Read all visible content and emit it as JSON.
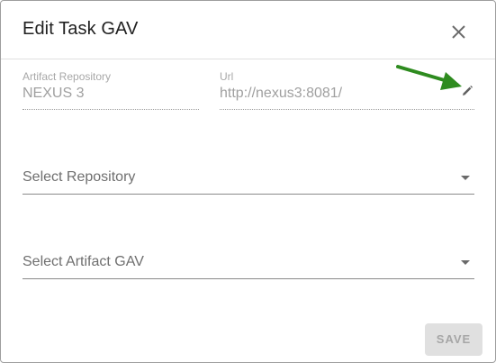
{
  "dialog": {
    "title": "Edit Task GAV",
    "close_icon": "close-icon"
  },
  "artifact_repository": {
    "label": "Artifact Repository",
    "value": "NEXUS 3"
  },
  "url": {
    "label": "Url",
    "value": "http://nexus3:8081/",
    "edit_icon": "pencil-icon"
  },
  "annotation": {
    "arrow_icon": "green-arrow-icon",
    "arrow_color": "#2e8b1f"
  },
  "select_repository": {
    "placeholder": "Select Repository",
    "icon": "caret-down-icon"
  },
  "select_artifact_gav": {
    "placeholder": "Select Artifact GAV",
    "icon": "caret-down-icon"
  },
  "footer": {
    "save_label": "SAVE",
    "save_disabled": true
  }
}
